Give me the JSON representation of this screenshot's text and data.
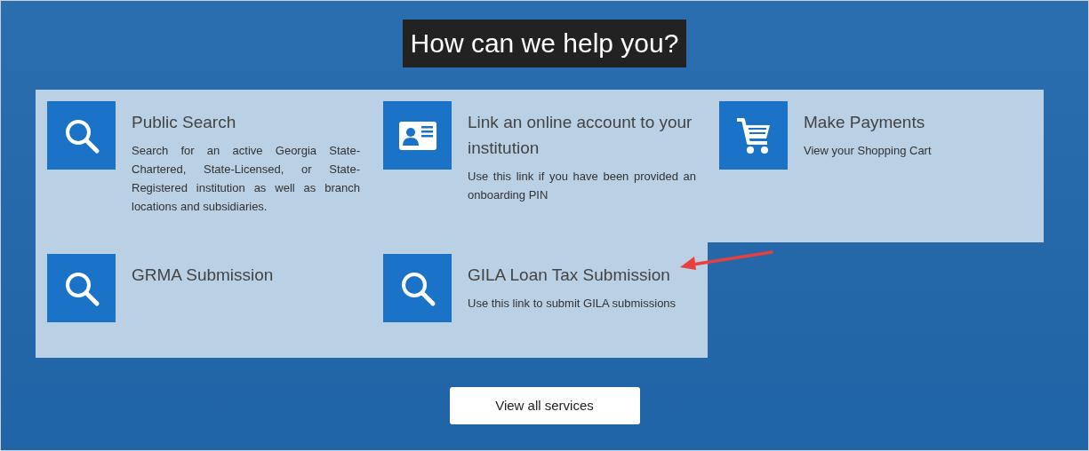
{
  "heading": "How can we help you?",
  "services": [
    {
      "kind": "search",
      "title": "Public Search",
      "description": "Search for an active Georgia State-Chartered, State-Licensed, or State-Registered institution as well as branch locations and subsidiaries."
    },
    {
      "kind": "id-card",
      "title": "Link an online account to your institution",
      "description": "Use this link if you have been provided an onboarding PIN"
    },
    {
      "kind": "cart",
      "title": "Make Payments",
      "description": "View your Shopping Cart"
    },
    {
      "kind": "search",
      "title": "GRMA Submission"
    },
    {
      "kind": "search",
      "title": "GILA Loan Tax Submission",
      "description": "Use this link to submit GILA submissions"
    }
  ],
  "annotation_arrow": true,
  "button": "View all services"
}
